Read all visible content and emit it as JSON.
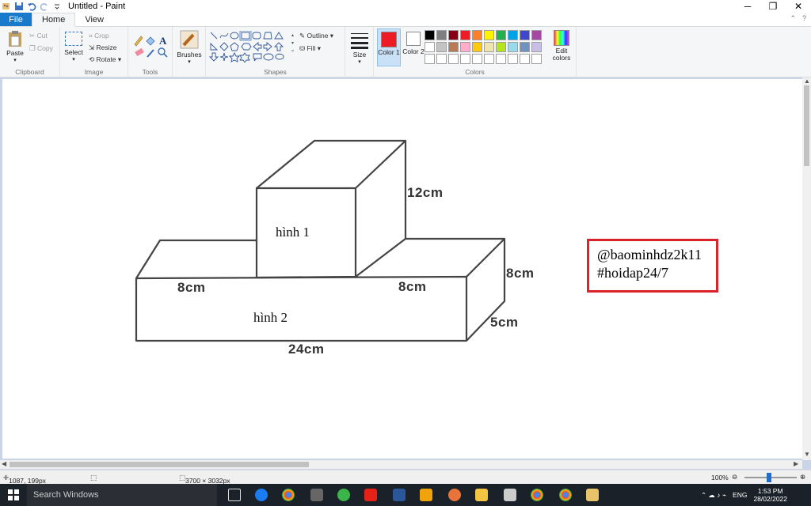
{
  "window": {
    "title": "Untitled - Paint",
    "controls": {
      "minimize": "─",
      "restore": "❐",
      "close": "✕"
    }
  },
  "tabs": [
    {
      "label": "File"
    },
    {
      "label": "Home"
    },
    {
      "label": "View"
    }
  ],
  "ribbon": {
    "clipboard": {
      "paste": "Paste",
      "cut": "Cut",
      "copy": "Copy",
      "label": "Clipboard"
    },
    "image": {
      "select": "Select",
      "crop": "Crop",
      "resize": "Resize",
      "rotate": "Rotate",
      "label": "Image"
    },
    "tools": {
      "label": "Tools"
    },
    "brushes": {
      "label": "Brushes"
    },
    "shapes": {
      "outline": "Outline",
      "fill": "Fill",
      "label": "Shapes"
    },
    "size": {
      "label": "Size"
    },
    "colors": {
      "color1": "Color 1",
      "color2": "Color 2",
      "edit": "Edit colors",
      "label": "Colors",
      "color1_value": "#ed1c24",
      "color2_value": "#ffffff",
      "palette_row1": [
        "#000000",
        "#7f7f7f",
        "#880015",
        "#ed1c24",
        "#ff7f27",
        "#fff200",
        "#22b14c",
        "#00a2e8",
        "#3f48cc",
        "#a349a4"
      ],
      "palette_row2": [
        "#ffffff",
        "#c3c3c3",
        "#b97a57",
        "#ffaec9",
        "#ffc90e",
        "#efe4b0",
        "#b5e61d",
        "#99d9ea",
        "#7092be",
        "#c8bfe7"
      ]
    }
  },
  "drawing": {
    "shape1_label": "hình 1",
    "shape2_label": "hình 2",
    "dim_12": "12cm",
    "dim_8_left": "8cm",
    "dim_8_mid": "8cm",
    "dim_8_right": "8cm",
    "dim_5": "5cm",
    "dim_24": "24cm"
  },
  "watermark": {
    "line1": "@baominhdz2k11",
    "line2": "#hoidap24/7",
    "border_color": "#d9242b"
  },
  "status": {
    "cursor": "1087, 199px",
    "image_size": "3700 × 3032px",
    "zoom": "100%"
  },
  "taskbar": {
    "search_placeholder": "Search Windows",
    "lang": "ENG",
    "time": "1:53 PM",
    "date": "28/02/2022"
  }
}
